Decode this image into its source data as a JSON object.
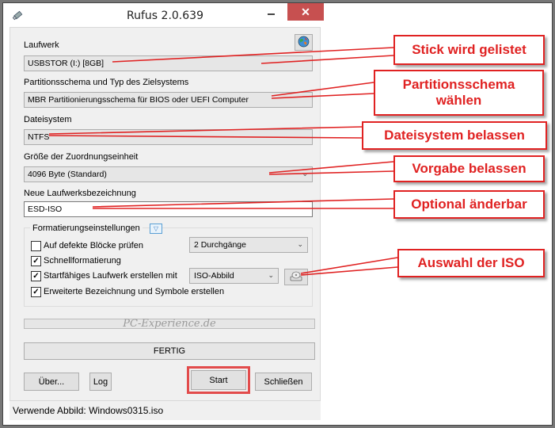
{
  "window": {
    "title": "Rufus 2.0.639",
    "close_glyph": "✕"
  },
  "device": {
    "label": "Laufwerk",
    "value": "USBSTOR (I:) [8GB]"
  },
  "partition": {
    "label": "Partitionsschema und Typ des Zielsystems",
    "value": "MBR Partitionierungsschema für BIOS oder UEFI Computer"
  },
  "filesystem": {
    "label": "Dateisystem",
    "value": "NTFS"
  },
  "cluster": {
    "label": "Größe der Zuordnungseinheit",
    "value": "4096 Byte (Standard)"
  },
  "volume_label": {
    "label": "Neue Laufwerksbezeichnung",
    "value": "ESD-ISO"
  },
  "format_options": {
    "title": "Formatierungseinstellungen",
    "toggle_glyph": "▽",
    "bad_blocks": {
      "label": "Auf defekte Blöcke prüfen",
      "checked": false,
      "passes": "2 Durchgänge"
    },
    "quick_format": {
      "label": "Schnellformatierung",
      "checked": true
    },
    "bootable": {
      "label": "Startfähiges Laufwerk erstellen mit",
      "checked": true,
      "type": "ISO-Abbild"
    },
    "extended_label": {
      "label": "Erweiterte Bezeichnung und Symbole erstellen",
      "checked": true
    },
    "check_glyph": "✓"
  },
  "watermark": "PC-Experience.de",
  "status": "FERTIG",
  "buttons": {
    "about": "Über...",
    "log": "Log",
    "start": "Start",
    "close": "Schließen"
  },
  "statusbar": "Verwende Abbild: Windows0315.iso",
  "dropdown_glyph": "⌄",
  "icons": {
    "app": "usb-drive-icon",
    "language": "globe-icon",
    "iso_select": "optical-drive-icon"
  },
  "callouts": {
    "stick": "Stick wird gelistet",
    "partition_line1": "Partitionsschema",
    "partition_line2": "wählen",
    "filesystem": "Dateisystem belassen",
    "cluster": "Vorgabe belassen",
    "label": "Optional änderbar",
    "iso": "Auswahl der ISO"
  },
  "colors": {
    "callout_red": "#e02222",
    "close_button": "#c75050",
    "start_highlight": "#e24b4b"
  }
}
